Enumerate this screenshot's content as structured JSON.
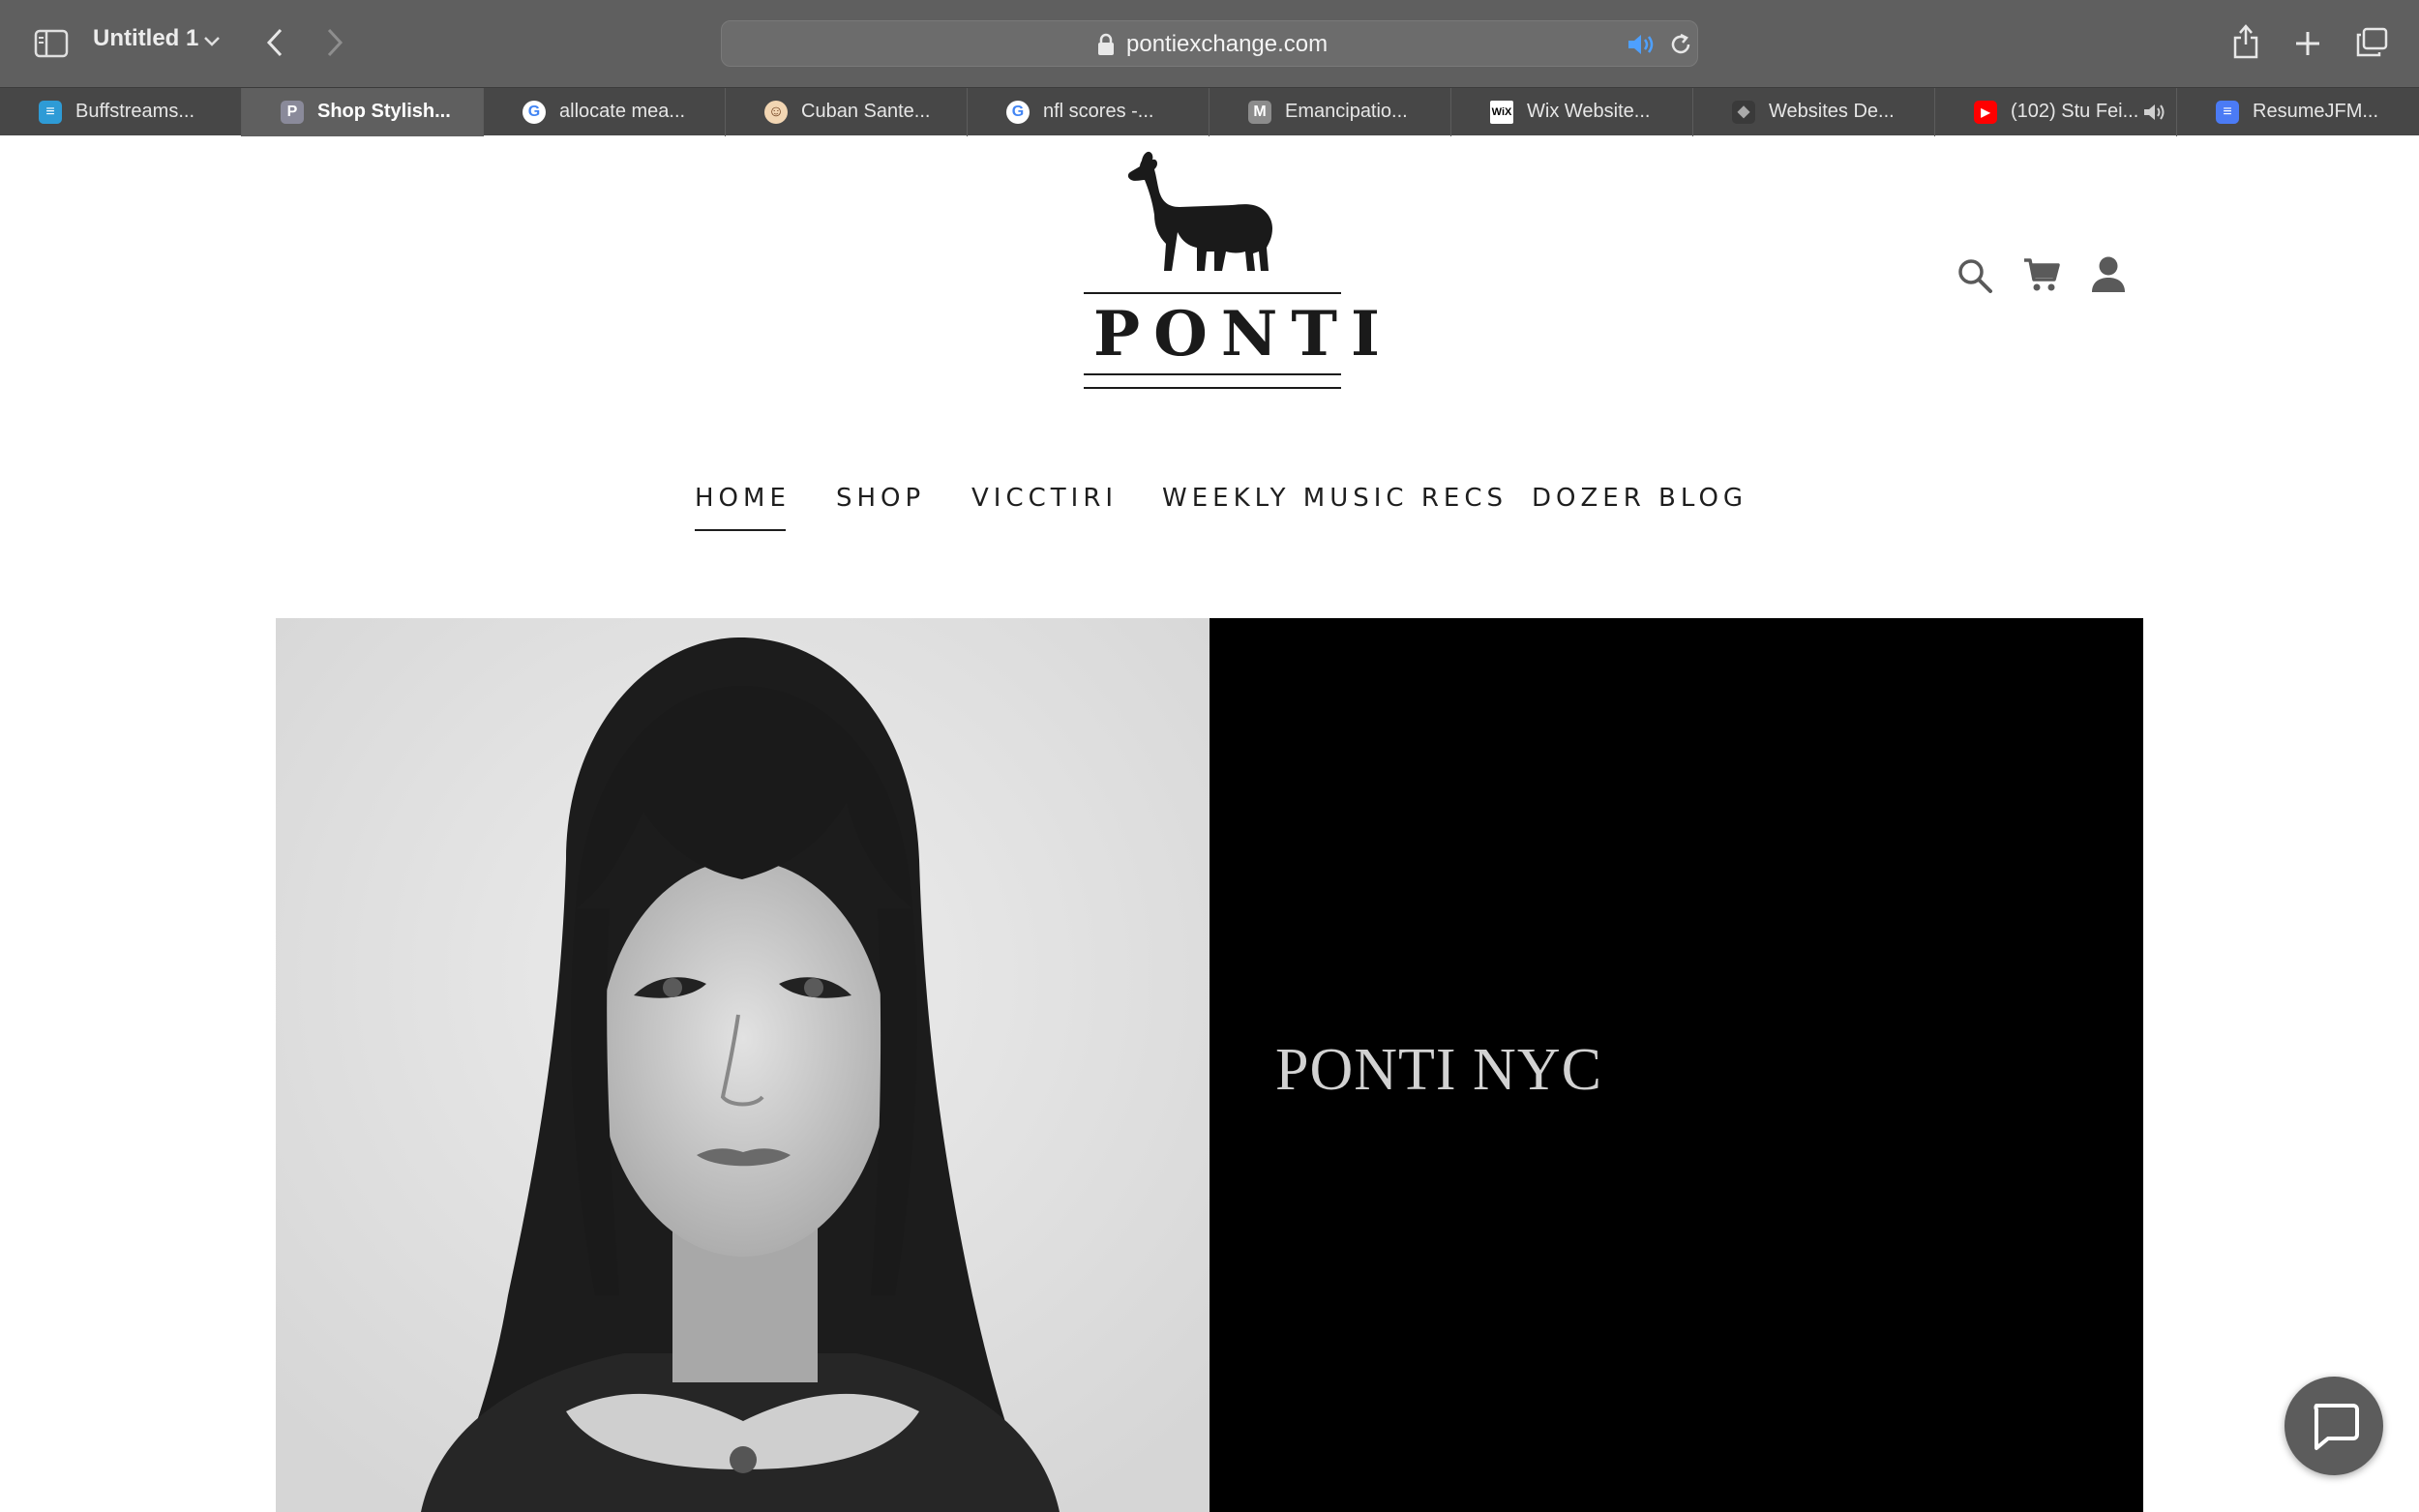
{
  "browser": {
    "window_title": "Untitled 1",
    "url": "pontiexchange.com",
    "tabs": [
      {
        "label": "Buffstreams...",
        "favicon": "buffstreams-favicon",
        "active": false
      },
      {
        "label": "Shop Stylish...",
        "favicon": "P",
        "active": true
      },
      {
        "label": "allocate mea...",
        "favicon": "google-favicon",
        "active": false
      },
      {
        "label": "Cuban Sante...",
        "favicon": "cuban-favicon",
        "active": false
      },
      {
        "label": "nfl scores -...",
        "favicon": "google-favicon",
        "active": false
      },
      {
        "label": "Emancipatio...",
        "favicon": "M",
        "active": false
      },
      {
        "label": "Wix Website...",
        "favicon": "WiX",
        "active": false
      },
      {
        "label": "Websites De...",
        "favicon": "box-favicon",
        "active": false
      },
      {
        "label": "(102) Stu Fei...",
        "favicon": "youtube-favicon",
        "active": false
      },
      {
        "label": "ResumeJFM...",
        "favicon": "docs-favicon",
        "active": false
      }
    ]
  },
  "site": {
    "logo_text": "PONTI",
    "nav": [
      {
        "label": "HOME",
        "active": true
      },
      {
        "label": "SHOP",
        "active": false
      },
      {
        "label": "VICCTIRI",
        "active": false
      },
      {
        "label": "WEEKLY MUSIC RECS",
        "active": false
      },
      {
        "label": "DOZER BLOG",
        "active": false
      }
    ],
    "header_icons": [
      "search-icon",
      "cart-icon",
      "account-icon"
    ],
    "hero_title": "PONTI NYC"
  },
  "colors": {
    "toolbar": "#5f5f5f",
    "tabstrip": "#474747",
    "page_bg": "#ffffff",
    "hero_dark": "#000000",
    "text_dark": "#1e1e1e"
  }
}
